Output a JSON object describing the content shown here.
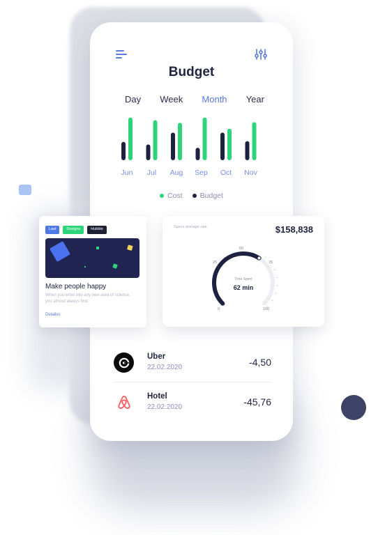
{
  "header": {
    "title": "Budget"
  },
  "tabs": [
    {
      "label": "Day",
      "active": false
    },
    {
      "label": "Week",
      "active": false
    },
    {
      "label": "Month",
      "active": true
    },
    {
      "label": "Year",
      "active": false
    }
  ],
  "colors": {
    "accent": "#5b7ae0",
    "cost": "#2ed47a",
    "budget": "#1d2240",
    "month_label": "#7b8fe8"
  },
  "chart_data": {
    "type": "bar",
    "categories": [
      "Jun",
      "Jul",
      "Aug",
      "Sep",
      "Oct",
      "Nov"
    ],
    "series": [
      {
        "name": "Budget",
        "values": [
          28,
          24,
          42,
          19,
          42,
          29
        ]
      },
      {
        "name": "Cost",
        "values": [
          65,
          61,
          57,
          65,
          48,
          58
        ]
      }
    ],
    "ylim": [
      0,
      70
    ],
    "grid": false,
    "legend": "bottom"
  },
  "legend": {
    "cost": "Cost",
    "budget": "Budget"
  },
  "card": {
    "tags": [
      "Last",
      "Designs",
      "Hubble"
    ],
    "title": "Make people happy",
    "description": "When you enter into any new area of science, you almost always find.",
    "link": "Detailes"
  },
  "gauge": {
    "label": "Specs average rate",
    "amount": "$158,838",
    "ticks": [
      "0",
      "25",
      "50",
      "75",
      "100"
    ],
    "value": 62,
    "value_label": "62 min",
    "caption": "Time Spent"
  },
  "transactions": [
    {
      "name": "Uber",
      "date": "22.02.2020",
      "amount": "-4,50",
      "icon": "uber-icon"
    },
    {
      "name": "Hotel",
      "date": "22.02.2020",
      "amount": "-45,76",
      "icon": "airbnb-icon"
    }
  ]
}
